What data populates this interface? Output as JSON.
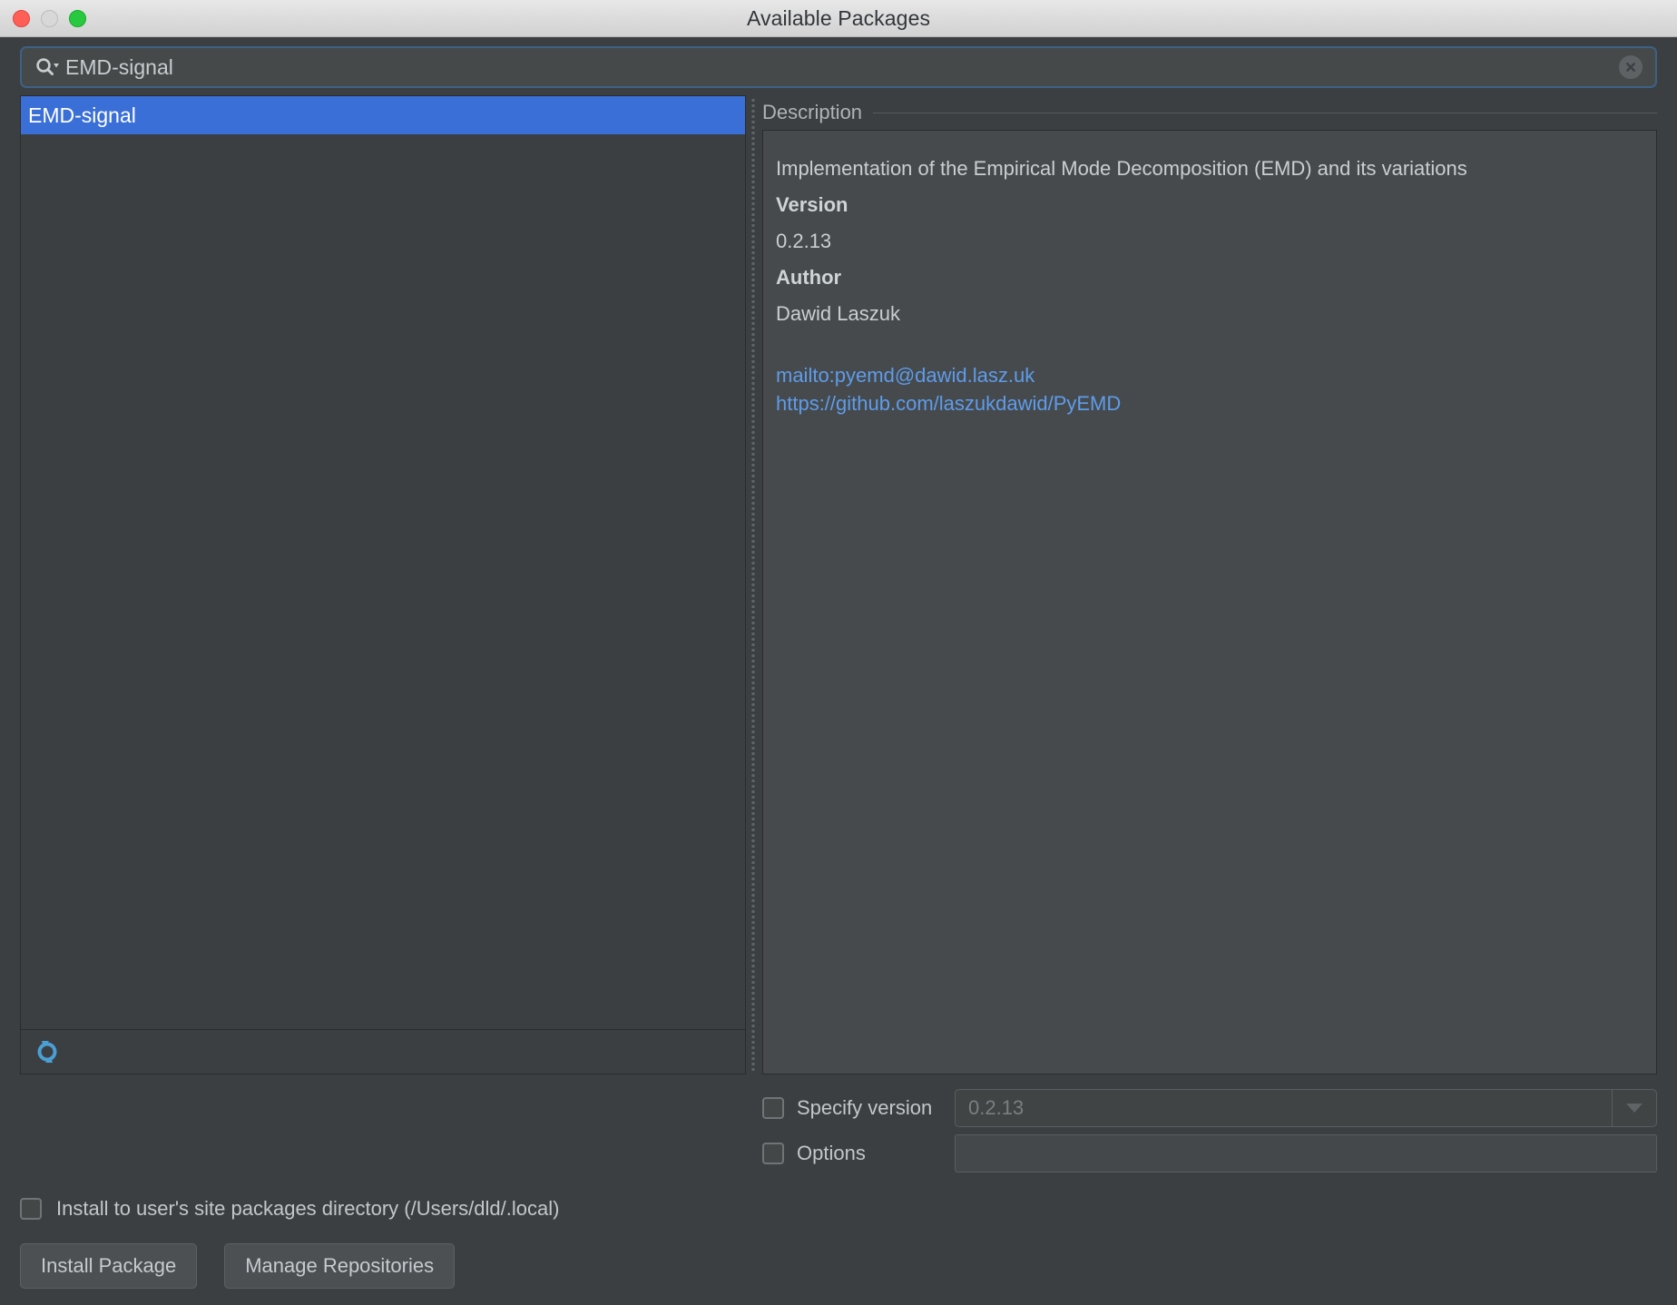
{
  "window": {
    "title": "Available Packages",
    "controls": {
      "close": "close-window",
      "minimize": "minimize-window",
      "maximize": "maximize-window"
    }
  },
  "search": {
    "icon": "search-icon",
    "value": "EMD-signal",
    "placeholder": "",
    "clear_icon": "clear-circle-x-icon"
  },
  "package_list": {
    "items": [
      {
        "name": "EMD-signal",
        "selected": true
      }
    ],
    "refresh_icon": "refresh-sync-icon"
  },
  "description": {
    "header": "Description",
    "summary": "Implementation of the Empirical Mode Decomposition (EMD) and its variations",
    "version_label": "Version",
    "version_value": "0.2.13",
    "author_label": "Author",
    "author_value": "Dawid Laszuk",
    "links": [
      "mailto:pyemd@dawid.lasz.uk",
      "https://github.com/laszukdawid/PyEMD"
    ]
  },
  "options": {
    "specify_version_label": "Specify version",
    "specify_version_checked": false,
    "specify_version_value": "0.2.13",
    "options_label": "Options",
    "options_checked": false,
    "options_value": ""
  },
  "footer": {
    "install_user_label": "Install to user's site packages directory (/Users/dld/.local)",
    "install_user_checked": false,
    "install_button": "Install Package",
    "manage_button": "Manage Repositories"
  },
  "colors": {
    "window_bg": "#3c3f41",
    "selection_blue": "#3a6fd8",
    "link_blue": "#5e9cea",
    "accent_icon_blue": "#4a9fd4",
    "focus_border": "#3d6185"
  }
}
